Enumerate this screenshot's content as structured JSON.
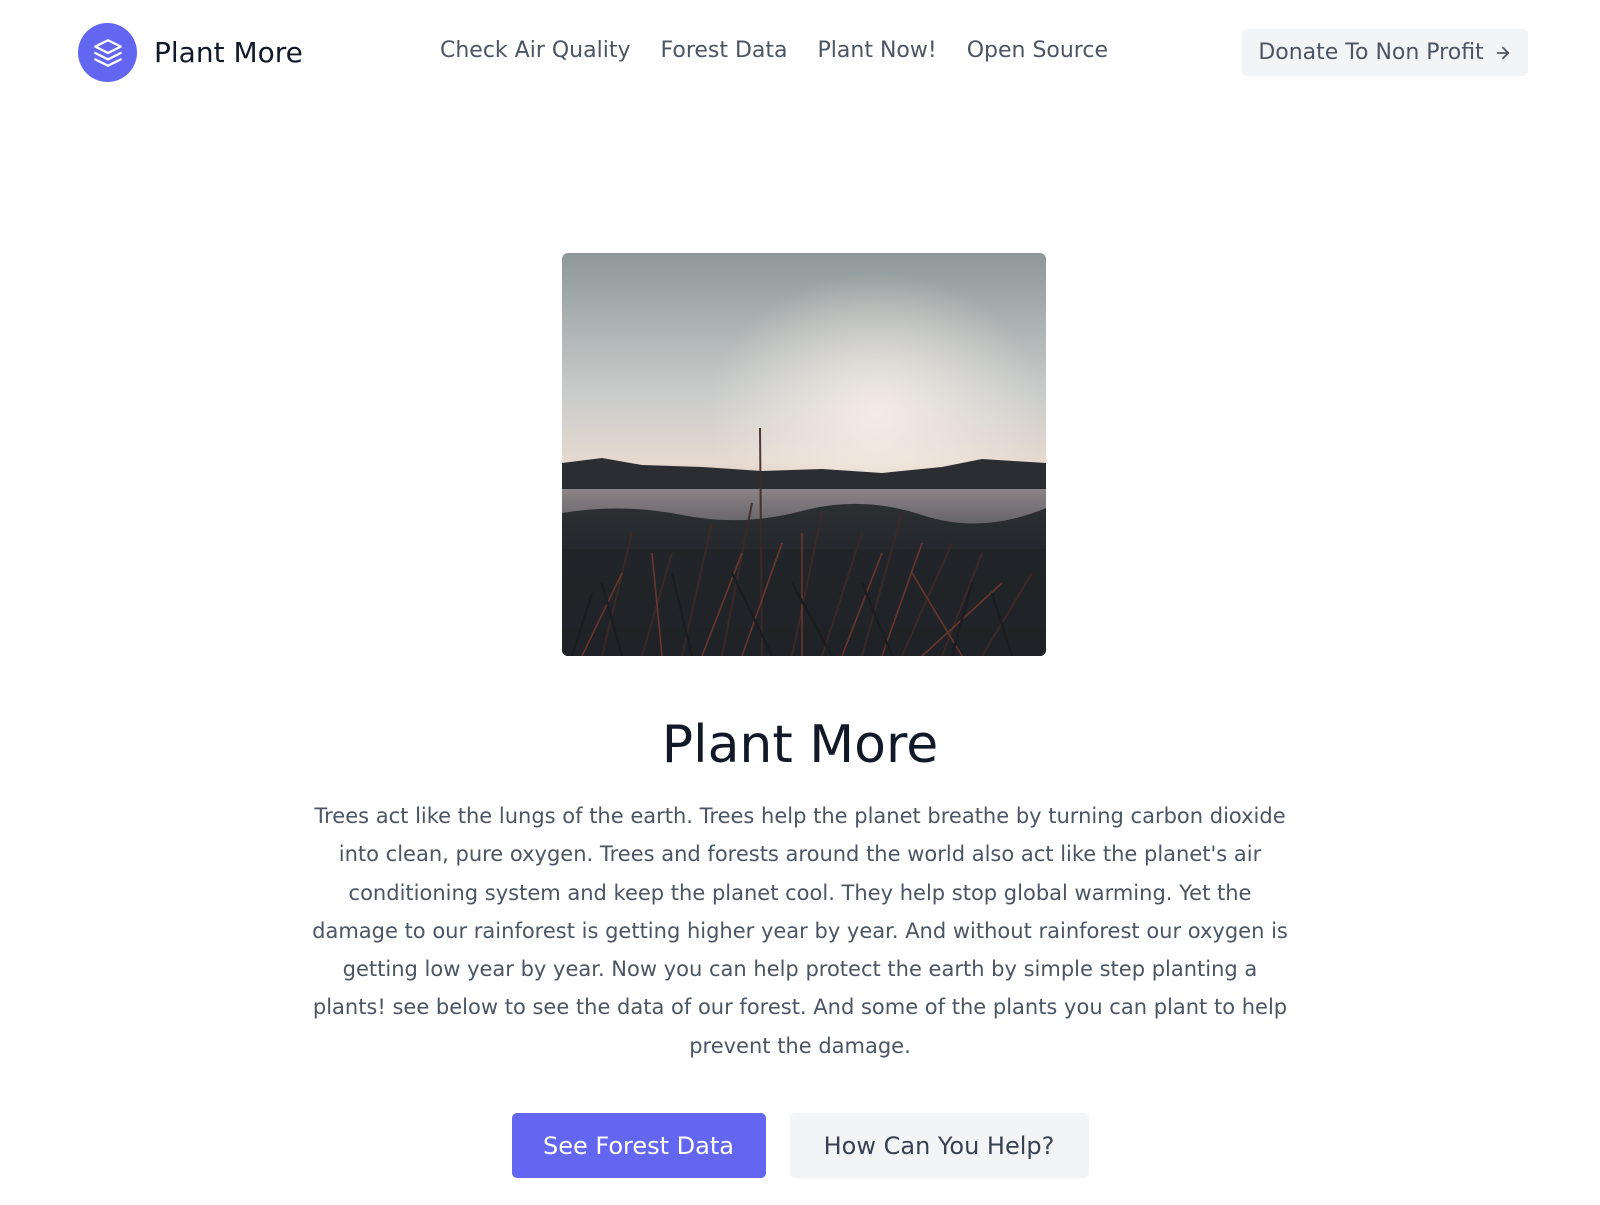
{
  "header": {
    "brand_name": "Plant More",
    "brand_icon": "stack-layers-icon",
    "nav": [
      {
        "label": "Check Air Quality"
      },
      {
        "label": "Forest Data"
      },
      {
        "label": "Plant Now!"
      },
      {
        "label": "Open Source"
      }
    ],
    "donate_label": "Donate To Non Profit",
    "donate_icon": "arrow-right-icon"
  },
  "hero": {
    "image": "wetland-grass-at-sunset-photo",
    "title": "Plant More",
    "description": "Trees act like the lungs of the earth. Trees help the planet breathe by turning carbon dioxide into clean, pure oxygen. Trees and forests around the world also act like the planet's air conditioning system and keep the planet cool. They help stop global warming. Yet the damage to our rainforest is getting higher year by year. And without rainforest our oxygen is getting low year by year. Now you can help protect the earth by simple step planting a plants! see below to see the data of our forest. And some of the plants you can plant to help prevent the damage.",
    "primary_button": "See Forest Data",
    "secondary_button": "How Can You Help?"
  },
  "colors": {
    "accent": "#6366f1",
    "heading": "#111827",
    "body_text": "#4b5563",
    "button_gray": "#f3f4f6"
  }
}
